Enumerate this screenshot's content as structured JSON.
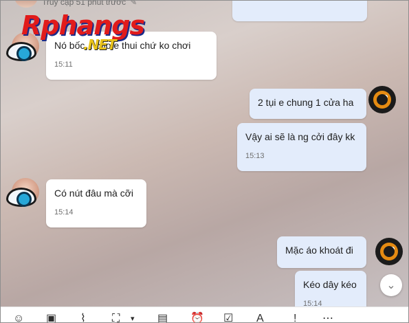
{
  "header": {
    "status_text": "Truy cập 51 phút trước"
  },
  "watermark": {
    "main": "Rphangs",
    "suffix": ".NET"
  },
  "messages": [
    {
      "side": "in",
      "text": "Nó bốc... cho e thui chứ ko chơi",
      "time": "15:11"
    },
    {
      "side": "out",
      "text": "2 tụi e chung 1 cửa ha",
      "time": ""
    },
    {
      "side": "out",
      "text": "Vậy ai sẽ là ng cởi đây kk",
      "time": "15:13"
    },
    {
      "side": "in",
      "text": "Có nút đâu mà cỡi",
      "time": "15:14"
    },
    {
      "side": "out",
      "text": "Mặc áo khoát đi",
      "time": ""
    },
    {
      "side": "out",
      "text": "Kéo dây kéo",
      "time": "15:14"
    }
  ],
  "icons": {
    "scroll_down": "chevron-down-icon",
    "toolbar": [
      "sticker-icon",
      "image-icon",
      "attachment-icon",
      "screenshot-icon",
      "dropdown-icon",
      "contact-card-icon",
      "reminder-icon",
      "task-icon",
      "text-format-icon",
      "exclamation-icon",
      "more-icon"
    ]
  },
  "colors": {
    "outgoing_bubble": "#e3ecfb",
    "incoming_bubble": "#ffffff",
    "watermark_red": "#e11b1b"
  }
}
